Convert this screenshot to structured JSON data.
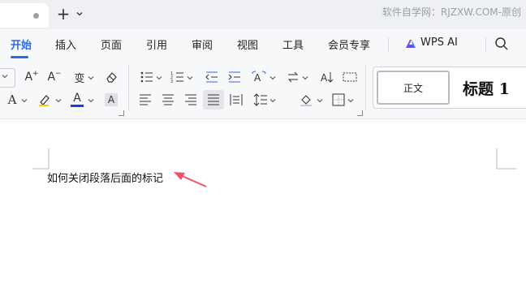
{
  "tabs": {
    "new_tab": "+"
  },
  "watermark": "软件自学网：RJZXW.COM-原创",
  "menu": {
    "items": [
      "开始",
      "插入",
      "页面",
      "引用",
      "审阅",
      "视图",
      "工具",
      "会员专享"
    ],
    "wps_ai": "WPS AI"
  },
  "toolbar": {
    "font_grow": "A",
    "font_shrink": "A",
    "phonetic": "wén",
    "highlight_letter": "A"
  },
  "styles": {
    "normal": "正文",
    "heading1": "标题 1"
  },
  "document": {
    "text": "如何关闭段落后面的标记"
  },
  "colors": {
    "accent": "#2b6ae6",
    "font_color_bar": "#1a3bdc",
    "annotation_arrow": "#f0506e"
  }
}
